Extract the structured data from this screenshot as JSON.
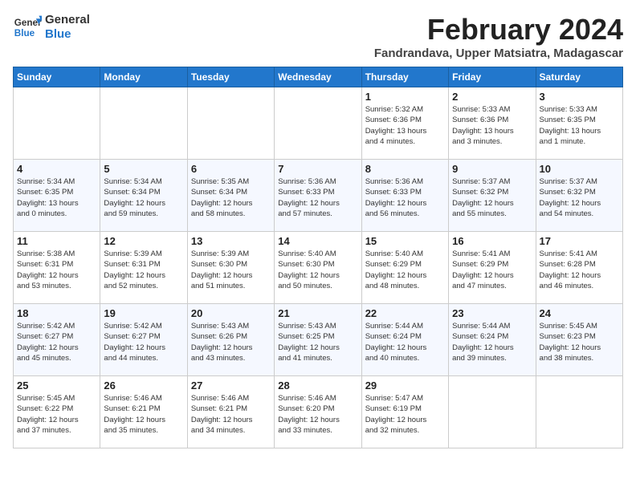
{
  "header": {
    "logo": {
      "line1": "General",
      "line2": "Blue"
    },
    "month": "February 2024",
    "location": "Fandrandava, Upper Matsiatra, Madagascar"
  },
  "weekdays": [
    "Sunday",
    "Monday",
    "Tuesday",
    "Wednesday",
    "Thursday",
    "Friday",
    "Saturday"
  ],
  "weeks": [
    [
      {
        "day": "",
        "info": ""
      },
      {
        "day": "",
        "info": ""
      },
      {
        "day": "",
        "info": ""
      },
      {
        "day": "",
        "info": ""
      },
      {
        "day": "1",
        "info": "Sunrise: 5:32 AM\nSunset: 6:36 PM\nDaylight: 13 hours\nand 4 minutes."
      },
      {
        "day": "2",
        "info": "Sunrise: 5:33 AM\nSunset: 6:36 PM\nDaylight: 13 hours\nand 3 minutes."
      },
      {
        "day": "3",
        "info": "Sunrise: 5:33 AM\nSunset: 6:35 PM\nDaylight: 13 hours\nand 1 minute."
      }
    ],
    [
      {
        "day": "4",
        "info": "Sunrise: 5:34 AM\nSunset: 6:35 PM\nDaylight: 13 hours\nand 0 minutes."
      },
      {
        "day": "5",
        "info": "Sunrise: 5:34 AM\nSunset: 6:34 PM\nDaylight: 12 hours\nand 59 minutes."
      },
      {
        "day": "6",
        "info": "Sunrise: 5:35 AM\nSunset: 6:34 PM\nDaylight: 12 hours\nand 58 minutes."
      },
      {
        "day": "7",
        "info": "Sunrise: 5:36 AM\nSunset: 6:33 PM\nDaylight: 12 hours\nand 57 minutes."
      },
      {
        "day": "8",
        "info": "Sunrise: 5:36 AM\nSunset: 6:33 PM\nDaylight: 12 hours\nand 56 minutes."
      },
      {
        "day": "9",
        "info": "Sunrise: 5:37 AM\nSunset: 6:32 PM\nDaylight: 12 hours\nand 55 minutes."
      },
      {
        "day": "10",
        "info": "Sunrise: 5:37 AM\nSunset: 6:32 PM\nDaylight: 12 hours\nand 54 minutes."
      }
    ],
    [
      {
        "day": "11",
        "info": "Sunrise: 5:38 AM\nSunset: 6:31 PM\nDaylight: 12 hours\nand 53 minutes."
      },
      {
        "day": "12",
        "info": "Sunrise: 5:39 AM\nSunset: 6:31 PM\nDaylight: 12 hours\nand 52 minutes."
      },
      {
        "day": "13",
        "info": "Sunrise: 5:39 AM\nSunset: 6:30 PM\nDaylight: 12 hours\nand 51 minutes."
      },
      {
        "day": "14",
        "info": "Sunrise: 5:40 AM\nSunset: 6:30 PM\nDaylight: 12 hours\nand 50 minutes."
      },
      {
        "day": "15",
        "info": "Sunrise: 5:40 AM\nSunset: 6:29 PM\nDaylight: 12 hours\nand 48 minutes."
      },
      {
        "day": "16",
        "info": "Sunrise: 5:41 AM\nSunset: 6:29 PM\nDaylight: 12 hours\nand 47 minutes."
      },
      {
        "day": "17",
        "info": "Sunrise: 5:41 AM\nSunset: 6:28 PM\nDaylight: 12 hours\nand 46 minutes."
      }
    ],
    [
      {
        "day": "18",
        "info": "Sunrise: 5:42 AM\nSunset: 6:27 PM\nDaylight: 12 hours\nand 45 minutes."
      },
      {
        "day": "19",
        "info": "Sunrise: 5:42 AM\nSunset: 6:27 PM\nDaylight: 12 hours\nand 44 minutes."
      },
      {
        "day": "20",
        "info": "Sunrise: 5:43 AM\nSunset: 6:26 PM\nDaylight: 12 hours\nand 43 minutes."
      },
      {
        "day": "21",
        "info": "Sunrise: 5:43 AM\nSunset: 6:25 PM\nDaylight: 12 hours\nand 41 minutes."
      },
      {
        "day": "22",
        "info": "Sunrise: 5:44 AM\nSunset: 6:24 PM\nDaylight: 12 hours\nand 40 minutes."
      },
      {
        "day": "23",
        "info": "Sunrise: 5:44 AM\nSunset: 6:24 PM\nDaylight: 12 hours\nand 39 minutes."
      },
      {
        "day": "24",
        "info": "Sunrise: 5:45 AM\nSunset: 6:23 PM\nDaylight: 12 hours\nand 38 minutes."
      }
    ],
    [
      {
        "day": "25",
        "info": "Sunrise: 5:45 AM\nSunset: 6:22 PM\nDaylight: 12 hours\nand 37 minutes."
      },
      {
        "day": "26",
        "info": "Sunrise: 5:46 AM\nSunset: 6:21 PM\nDaylight: 12 hours\nand 35 minutes."
      },
      {
        "day": "27",
        "info": "Sunrise: 5:46 AM\nSunset: 6:21 PM\nDaylight: 12 hours\nand 34 minutes."
      },
      {
        "day": "28",
        "info": "Sunrise: 5:46 AM\nSunset: 6:20 PM\nDaylight: 12 hours\nand 33 minutes."
      },
      {
        "day": "29",
        "info": "Sunrise: 5:47 AM\nSunset: 6:19 PM\nDaylight: 12 hours\nand 32 minutes."
      },
      {
        "day": "",
        "info": ""
      },
      {
        "day": "",
        "info": ""
      }
    ]
  ]
}
